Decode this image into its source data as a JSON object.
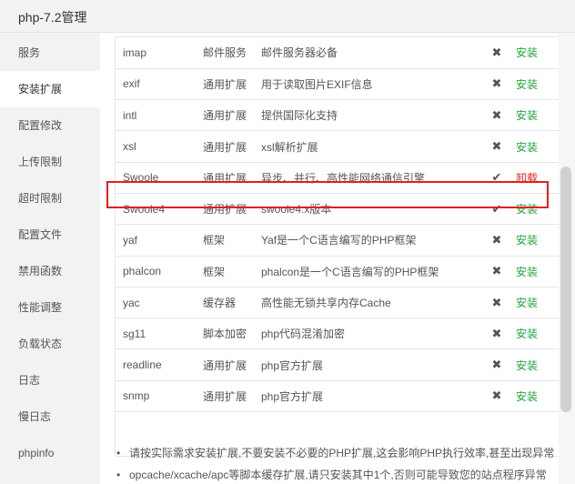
{
  "window": {
    "title": "php-7.2管理"
  },
  "sidebar": {
    "active_index": 1,
    "items": [
      {
        "label": "服务"
      },
      {
        "label": "安装扩展"
      },
      {
        "label": "配置修改"
      },
      {
        "label": "上传限制"
      },
      {
        "label": "超时限制"
      },
      {
        "label": "配置文件"
      },
      {
        "label": "禁用函数"
      },
      {
        "label": "性能调整"
      },
      {
        "label": "负载状态"
      },
      {
        "label": "日志"
      },
      {
        "label": "慢日志"
      },
      {
        "label": "phpinfo"
      }
    ]
  },
  "extensions": {
    "highlighted_index": 3,
    "rows": [
      {
        "name": "imap",
        "type": "邮件服务",
        "desc": "邮件服务器必备",
        "status": "✖",
        "status_icon": "cross-icon",
        "action": "安装",
        "action_color": "#20a53a"
      },
      {
        "name": "exif",
        "type": "通用扩展",
        "desc": "用于读取图片EXIF信息",
        "status": "✖",
        "status_icon": "cross-icon",
        "action": "安装",
        "action_color": "#20a53a"
      },
      {
        "name": "intl",
        "type": "通用扩展",
        "desc": "提供国际化支持",
        "status": "✖",
        "status_icon": "cross-icon",
        "action": "安装",
        "action_color": "#20a53a"
      },
      {
        "name": "xsl",
        "type": "通用扩展",
        "desc": "xsl解析扩展",
        "status": "✖",
        "status_icon": "cross-icon",
        "action": "安装",
        "action_color": "#20a53a"
      },
      {
        "name": "Swoole",
        "type": "通用扩展",
        "desc": "异步、并行、高性能网络通信引擎",
        "status": "✔",
        "status_icon": "check-icon",
        "action": "卸载",
        "action_color": "#e02020"
      },
      {
        "name": "Swoole4",
        "type": "通用扩展",
        "desc": "swoole4.x版本",
        "status": "✔",
        "status_icon": "check-icon",
        "action": "安装",
        "action_color": "#20a53a"
      },
      {
        "name": "yaf",
        "type": "框架",
        "desc": "Yaf是一个C语言编写的PHP框架",
        "status": "✖",
        "status_icon": "cross-icon",
        "action": "安装",
        "action_color": "#20a53a"
      },
      {
        "name": "phalcon",
        "type": "框架",
        "desc": "phalcon是一个C语言编写的PHP框架",
        "status": "✖",
        "status_icon": "cross-icon",
        "action": "安装",
        "action_color": "#20a53a"
      },
      {
        "name": "yac",
        "type": "缓存器",
        "desc": "高性能无锁共享内存Cache",
        "status": "✖",
        "status_icon": "cross-icon",
        "action": "安装",
        "action_color": "#20a53a"
      },
      {
        "name": "sg11",
        "type": "脚本加密",
        "desc": "php代码混淆加密",
        "status": "✖",
        "status_icon": "cross-icon",
        "action": "安装",
        "action_color": "#20a53a"
      },
      {
        "name": "readline",
        "type": "通用扩展",
        "desc": "php官方扩展",
        "status": "✖",
        "status_icon": "cross-icon",
        "action": "安装",
        "action_color": "#20a53a"
      },
      {
        "name": "snmp",
        "type": "通用扩展",
        "desc": "php官方扩展",
        "status": "✖",
        "status_icon": "cross-icon",
        "action": "安装",
        "action_color": "#20a53a"
      }
    ]
  },
  "notes": [
    "请按实际需求安装扩展,不要安装不必要的PHP扩展,这会影响PHP执行效率,甚至出现异常",
    "opcache/xcache/apc等脚本缓存扩展,请只安装其中1个,否则可能导致您的站点程序异常"
  ],
  "colors": {
    "install": "#20a53a",
    "uninstall": "#e02020",
    "highlight_border": "#e02020"
  }
}
